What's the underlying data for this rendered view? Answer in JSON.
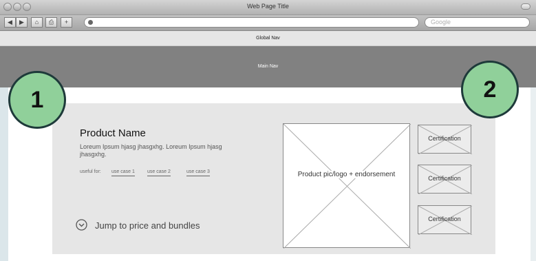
{
  "browser": {
    "window_title": "Web Page Title",
    "search_placeholder": "Google"
  },
  "nav": {
    "global": "Global Nav",
    "main": "Main Nav"
  },
  "product": {
    "name": "Product Name",
    "description": "Loreum Ipsum hjasg jhasgxhg. Loreum Ipsum hjasg jhasgxhg.",
    "useful_for_label": "useful for:",
    "use_cases": [
      "use case 1",
      "use case 2",
      "use case 3"
    ],
    "jump_label": "Jump to price and bundles",
    "image_label": "Product pic/logo + endorsement",
    "certifications": [
      "Certification",
      "Certification",
      "Certification"
    ]
  },
  "callouts": [
    "1",
    "2"
  ]
}
